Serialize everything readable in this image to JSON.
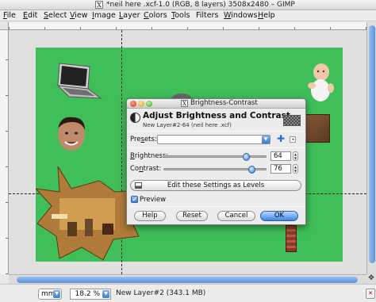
{
  "window": {
    "x_badge": "X",
    "title": "*neil here .xcf-1.0 (RGB, 8 layers) 3508x2480 – GIMP"
  },
  "menubar": {
    "items": [
      {
        "key": "F",
        "rest": "ile"
      },
      {
        "key": "E",
        "rest": "dit"
      },
      {
        "key": "S",
        "rest": "elect"
      },
      {
        "key": "V",
        "rest": "iew"
      },
      {
        "key": "I",
        "rest": "mage"
      },
      {
        "key": "L",
        "rest": "ayer"
      },
      {
        "key": "C",
        "rest": "olors"
      },
      {
        "key": "T",
        "rest": "ools"
      },
      {
        "key": "",
        "rest": "Filters"
      },
      {
        "key": "W",
        "rest": "indows"
      },
      {
        "key": "H",
        "rest": "elp"
      }
    ]
  },
  "canvas": {
    "background_color": "#3fbe5a",
    "objects": [
      "laptop",
      "baby",
      "face",
      "star-photo",
      "book",
      "tower"
    ]
  },
  "statusbar": {
    "unit": "mm",
    "zoom": "18.2 %",
    "layer_info": "New Layer#2 (343.1 MB)"
  },
  "dialog": {
    "x_badge": "X",
    "window_title": "Brightness-Contrast",
    "heading": "Adjust Brightness and Contrast",
    "subheading": "New Layer#2-64 (neil here .xcf)",
    "presets": {
      "key": "s",
      "label": "Pre",
      "label2": "ets:",
      "value": ""
    },
    "brightness": {
      "key": "B",
      "rest": "rightness:",
      "value": "64",
      "fraction": 0.82
    },
    "contrast": {
      "key": "n",
      "pre": "Co",
      "rest": "trast:",
      "value": "76",
      "fraction": 0.88
    },
    "levels_button": "Edit these Settings as Levels",
    "preview": {
      "label": "Preview",
      "checked": true
    },
    "buttons": {
      "help": "Help",
      "reset": "Reset",
      "cancel": "Cancel",
      "ok": "OK"
    }
  },
  "colors": {
    "accent": "#3f7bd5",
    "canvas_green": "#3fbe5a"
  }
}
